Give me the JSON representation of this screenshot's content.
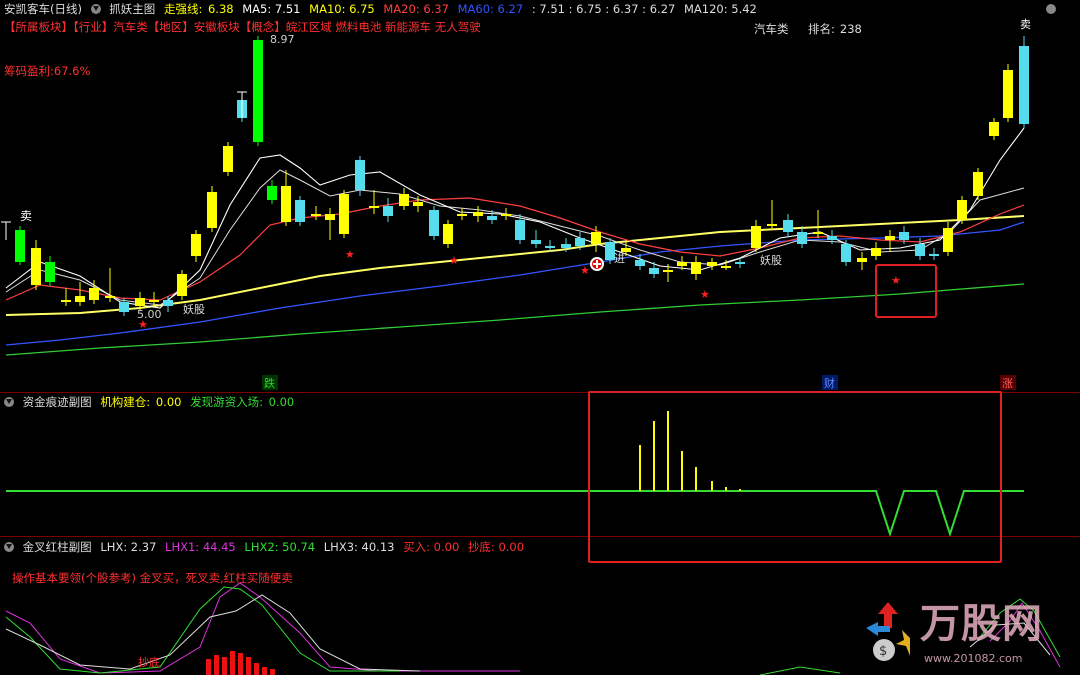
{
  "main": {
    "title": "安凯客车(日线)",
    "indicator_name": "抓妖主图",
    "strong_label": "走强线:",
    "strong_value": "6.38",
    "ma5": "MA5: 7.51",
    "ma10": "MA10: 6.75",
    "ma20": "MA20: 6.37",
    "ma60": "MA60: 6.27",
    "vals_extra": ": 7.51 : 6.75 : 6.37 : 6.27",
    "ma120": "MA120: 5.42",
    "info_line": "【所属板块】【行业】汽车类【地区】安徽板块【概念】皖江区域 燃料电池 新能源车 无人驾驶",
    "chip_profit": "筹码盈利:67.6%",
    "industry": "汽车类",
    "rank_label": "排名:",
    "rank_value": "238",
    "high_price": "8.97",
    "low_price": "5.00",
    "sell_mark": "卖",
    "top_mark": "卖",
    "yao_gu": "妖股",
    "jin_mark": "进",
    "bottom_labels": {
      "die": "跌",
      "cai": "财",
      "zhang": "涨"
    },
    "colors": {
      "up": "#ffff00",
      "down": "#00ff00",
      "cyan": "#55ddee",
      "ma5": "#ffffff",
      "ma10": "#ffff00",
      "ma20": "#ff4040",
      "ma60": "#3355ff",
      "ma120": "#33cc33"
    }
  },
  "sub1": {
    "name": "资金痕迹副图",
    "inst_label": "机构建仓:",
    "inst_value": "0.00",
    "hot_label": "发现游资入场:",
    "hot_value": "0.00"
  },
  "sub2": {
    "name": "金叉红柱副图",
    "lhx": "LHX: 2.37",
    "lhx1": "LHX1: 44.45",
    "lhx2": "LHX2: 50.74",
    "lhx3": "LHX3: 40.13",
    "buy": "买入: 0.00",
    "bottom": "抄底: 0.00",
    "note": "操作基本要领(个股参考) 金叉买，死叉卖,红柱买随便卖",
    "chaodi": "抄底"
  },
  "watermark": {
    "brand": "万股网",
    "url": "www.201082.com"
  }
}
